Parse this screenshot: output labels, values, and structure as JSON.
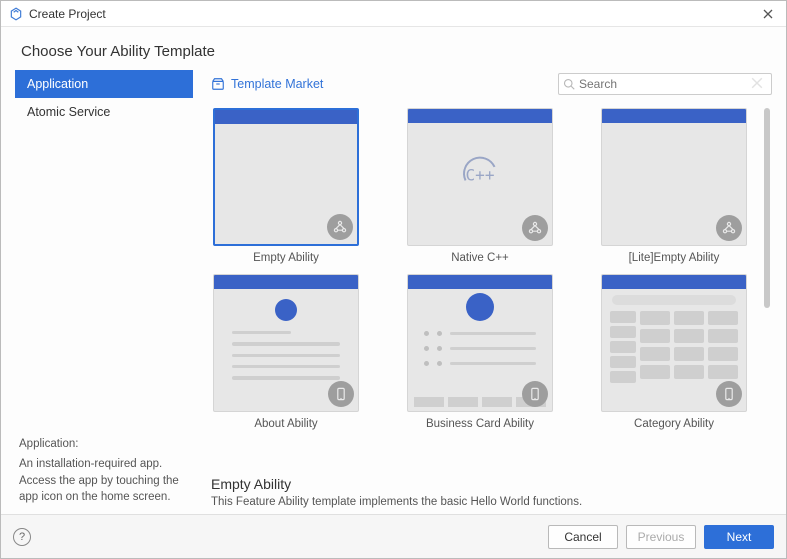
{
  "window": {
    "title": "Create Project"
  },
  "heading": "Choose Your Ability Template",
  "sidebar": {
    "items": [
      {
        "label": "Application",
        "active": true
      },
      {
        "label": "Atomic Service",
        "active": false
      }
    ],
    "desc_title": "Application:",
    "desc_body": "An installation-required app. Access the app by touching the app icon on the home screen."
  },
  "topbar": {
    "market_label": "Template Market",
    "search_placeholder": "Search"
  },
  "templates": [
    {
      "id": "empty",
      "name": "Empty Ability",
      "badge": "multi",
      "selected": true,
      "preview": "blank"
    },
    {
      "id": "native",
      "name": "Native C++",
      "badge": "multi",
      "selected": false,
      "preview": "cpp"
    },
    {
      "id": "lite",
      "name": "[Lite]Empty Ability",
      "badge": "multi",
      "selected": false,
      "preview": "blank"
    },
    {
      "id": "about",
      "name": "About Ability",
      "badge": "device",
      "selected": false,
      "preview": "about"
    },
    {
      "id": "bizcard",
      "name": "Business Card Ability",
      "badge": "device",
      "selected": false,
      "preview": "biz"
    },
    {
      "id": "category",
      "name": "Category Ability",
      "badge": "device",
      "selected": false,
      "preview": "cat"
    }
  ],
  "selected": {
    "title": "Empty Ability",
    "description": "This Feature Ability template implements the basic Hello World functions."
  },
  "footer": {
    "cancel": "Cancel",
    "previous": "Previous",
    "next": "Next",
    "previous_enabled": false
  },
  "colors": {
    "accent": "#2d6fd8"
  }
}
